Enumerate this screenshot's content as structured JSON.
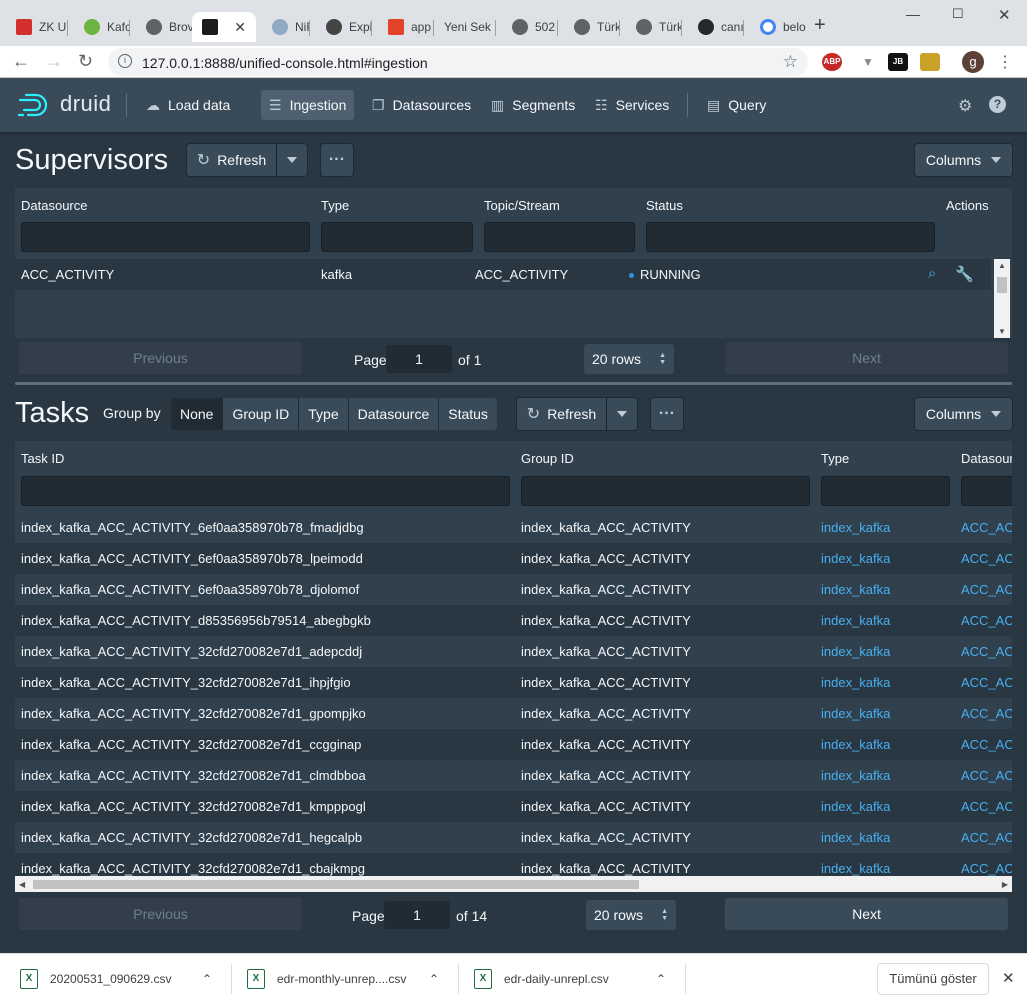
{
  "browser": {
    "tabs": [
      "ZK U",
      "Kafc",
      "Brov",
      "",
      "NiFi",
      "Expl",
      "app",
      "Yeni Sek",
      "502",
      "Türk",
      "Türk",
      "canı",
      "belo"
    ],
    "address": "127.0.0.1:8888/unified-console.html#ingestion",
    "ext_abp": "ABP",
    "ext_jb": "JB",
    "profile_initial": "g"
  },
  "app": {
    "logo_text": "druid",
    "nav": {
      "load_data": "Load data",
      "ingestion": "Ingestion",
      "datasources": "Datasources",
      "segments": "Segments",
      "services": "Services",
      "query": "Query"
    }
  },
  "supervisors": {
    "title": "Supervisors",
    "refresh_label": "Refresh",
    "columns_label": "Columns",
    "headers": [
      "Datasource",
      "Type",
      "Topic/Stream",
      "Status",
      "Actions"
    ],
    "rows": [
      {
        "datasource": "ACC_ACTIVITY",
        "type": "kafka",
        "topic": "ACC_ACTIVITY",
        "status": "RUNNING"
      }
    ],
    "pagination": {
      "previous": "Previous",
      "page_label": "Page",
      "page": "1",
      "of": "of 1",
      "rows": "20 rows",
      "next": "Next"
    }
  },
  "tasks": {
    "title": "Tasks",
    "group_by_label": "Group by",
    "group_options": [
      "None",
      "Group ID",
      "Type",
      "Datasource",
      "Status"
    ],
    "refresh_label": "Refresh",
    "columns_label": "Columns",
    "headers": [
      "Task ID",
      "Group ID",
      "Type",
      "Datasour"
    ],
    "rows": [
      {
        "task_id": "index_kafka_ACC_ACTIVITY_6ef0aa358970b78_fmadjdbg",
        "group_id": "index_kafka_ACC_ACTIVITY",
        "type": "index_kafka",
        "datasource": "ACC_ACT"
      },
      {
        "task_id": "index_kafka_ACC_ACTIVITY_6ef0aa358970b78_lpeimodd",
        "group_id": "index_kafka_ACC_ACTIVITY",
        "type": "index_kafka",
        "datasource": "ACC_ACT"
      },
      {
        "task_id": "index_kafka_ACC_ACTIVITY_6ef0aa358970b78_djolomof",
        "group_id": "index_kafka_ACC_ACTIVITY",
        "type": "index_kafka",
        "datasource": "ACC_ACT"
      },
      {
        "task_id": "index_kafka_ACC_ACTIVITY_d85356956b79514_abegbgkb",
        "group_id": "index_kafka_ACC_ACTIVITY",
        "type": "index_kafka",
        "datasource": "ACC_ACT"
      },
      {
        "task_id": "index_kafka_ACC_ACTIVITY_32cfd270082e7d1_adepcddj",
        "group_id": "index_kafka_ACC_ACTIVITY",
        "type": "index_kafka",
        "datasource": "ACC_ACT"
      },
      {
        "task_id": "index_kafka_ACC_ACTIVITY_32cfd270082e7d1_ihpjfgio",
        "group_id": "index_kafka_ACC_ACTIVITY",
        "type": "index_kafka",
        "datasource": "ACC_ACT"
      },
      {
        "task_id": "index_kafka_ACC_ACTIVITY_32cfd270082e7d1_gpompjko",
        "group_id": "index_kafka_ACC_ACTIVITY",
        "type": "index_kafka",
        "datasource": "ACC_ACT"
      },
      {
        "task_id": "index_kafka_ACC_ACTIVITY_32cfd270082e7d1_ccgginap",
        "group_id": "index_kafka_ACC_ACTIVITY",
        "type": "index_kafka",
        "datasource": "ACC_ACT"
      },
      {
        "task_id": "index_kafka_ACC_ACTIVITY_32cfd270082e7d1_clmdbboa",
        "group_id": "index_kafka_ACC_ACTIVITY",
        "type": "index_kafka",
        "datasource": "ACC_ACT"
      },
      {
        "task_id": "index_kafka_ACC_ACTIVITY_32cfd270082e7d1_kmpppogl",
        "group_id": "index_kafka_ACC_ACTIVITY",
        "type": "index_kafka",
        "datasource": "ACC_ACT"
      },
      {
        "task_id": "index_kafka_ACC_ACTIVITY_32cfd270082e7d1_hegcalpb",
        "group_id": "index_kafka_ACC_ACTIVITY",
        "type": "index_kafka",
        "datasource": "ACC_ACT"
      },
      {
        "task_id": "index_kafka_ACC_ACTIVITY_32cfd270082e7d1_cbajkmpg",
        "group_id": "index_kafka_ACC_ACTIVITY",
        "type": "index_kafka",
        "datasource": "ACC_ACT"
      }
    ],
    "pagination": {
      "previous": "Previous",
      "page_label": "Page",
      "page": "1",
      "of": "of 14",
      "rows": "20 rows",
      "next": "Next"
    }
  },
  "downloads": {
    "items": [
      "20200531_090629.csv",
      "edr-monthly-unrep....csv",
      "edr-daily-unrepl.csv"
    ],
    "show_all": "Tümünü göster"
  },
  "colors": {
    "accent": "#48aff0",
    "bg": "#293742",
    "navbar": "#394b59"
  }
}
